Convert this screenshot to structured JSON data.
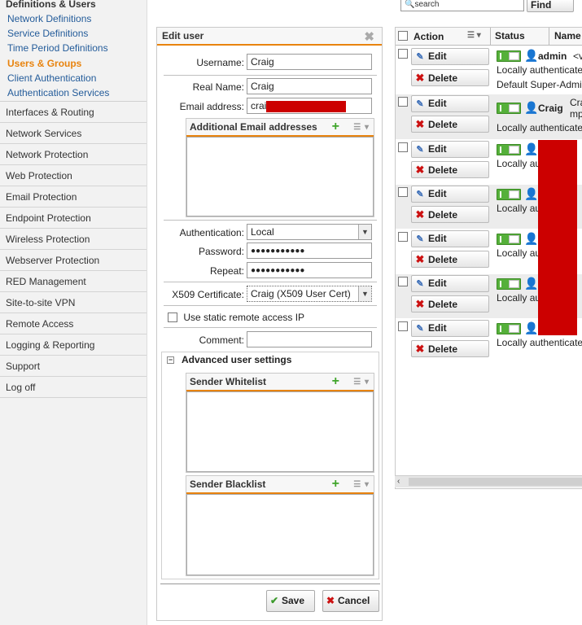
{
  "sidebar": {
    "section_title": "Definitions & Users",
    "sub_items": [
      {
        "label": "Network Definitions",
        "active": false
      },
      {
        "label": "Service Definitions",
        "active": false
      },
      {
        "label": "Time Period Definitions",
        "active": false
      },
      {
        "label": "Users & Groups",
        "active": true
      },
      {
        "label": "Client Authentication",
        "active": false
      },
      {
        "label": "Authentication Services",
        "active": false
      }
    ],
    "items": [
      "Interfaces & Routing",
      "Network Services",
      "Network Protection",
      "Web Protection",
      "Email Protection",
      "Endpoint Protection",
      "Wireless Protection",
      "Webserver Protection",
      "RED Management",
      "Site-to-site VPN",
      "Remote Access",
      "Logging & Reporting",
      "Support",
      "Log off"
    ]
  },
  "search": {
    "placeholder": "search",
    "find_label": "Find"
  },
  "dialog": {
    "title": "Edit user",
    "close_glyph": "✖",
    "username_label": "Username:",
    "username_value": "Craig",
    "realname_label": "Real Name:",
    "realname_value": "Craig",
    "email_label": "Email address:",
    "email_value": "crai",
    "additional_email_title": "Additional Email addresses",
    "authentication_label": "Authentication:",
    "authentication_value": "Local",
    "password_label": "Password:",
    "password_value": "●●●●●●●●●●●",
    "repeat_label": "Repeat:",
    "repeat_value": "●●●●●●●●●●●",
    "x509_label": "X509 Certificate:",
    "x509_value": "Craig (X509 User Cert)",
    "static_ip_label": "Use static remote access IP",
    "comment_label": "Comment:",
    "comment_value": "",
    "advanced_title": "Advanced user settings",
    "whitelist_title": "Sender Whitelist",
    "blacklist_title": "Sender Blacklist",
    "save_label": "Save",
    "cancel_label": "Cancel"
  },
  "list": {
    "col_action": "Action",
    "col_status": "Status",
    "col_name": "Name",
    "edit_label": "Edit",
    "delete_label": "Delete",
    "rows": [
      {
        "name": "admin",
        "name_suffix": "<v",
        "line1": "Locally authenticate",
        "line2": "Default Super-Admin",
        "alt": false
      },
      {
        "name": "Craig",
        "name_suffix": "Cra",
        "line1": "Locally authenticate",
        "line1b": "mp",
        "alt": true
      },
      {
        "name": "",
        "line1": "Locally au",
        "alt": false
      },
      {
        "name": "",
        "line1": "Locally au",
        "alt": true
      },
      {
        "name": "",
        "line1": "Locally au",
        "alt": false
      },
      {
        "name": "",
        "line1": "Locally au",
        "alt": true
      },
      {
        "name": "",
        "line1": "Locally authenticate",
        "alt": false
      }
    ]
  },
  "colors": {
    "accent": "#e8830e",
    "link": "#245c9a",
    "toggle_on": "#55b03a",
    "delete": "#cc1111",
    "redaction": "#cc0000"
  }
}
